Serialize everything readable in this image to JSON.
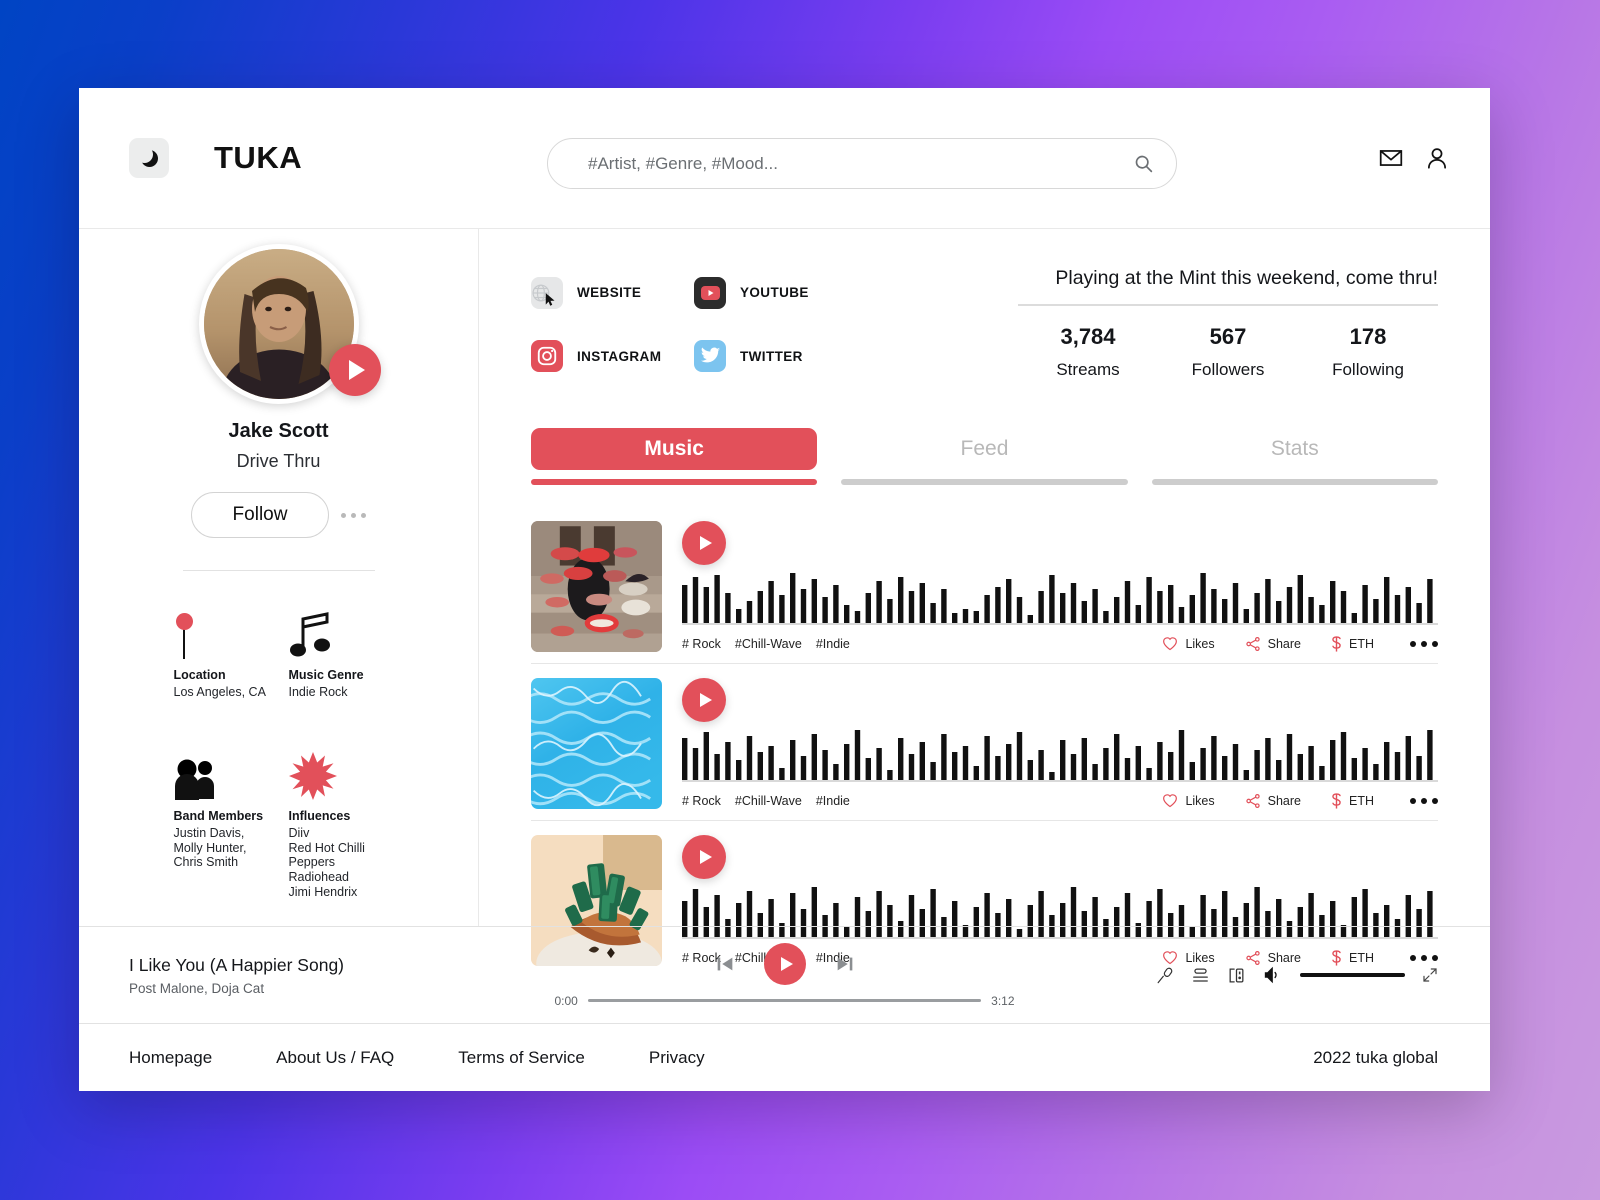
{
  "header": {
    "brand": "TUKA",
    "theme_toggle_icon": "moon-icon",
    "search_placeholder": "#Artist, #Genre, #Mood...",
    "search_value": "",
    "search_icon": "search-icon",
    "mail_icon": "mail-icon",
    "account_icon": "user-icon"
  },
  "sidebar": {
    "name": "Jake Scott",
    "subtitle": "Drive Thru",
    "follow_label": "Follow",
    "more_icon": "more-dots-icon",
    "play_icon": "play-icon",
    "info": [
      {
        "icon": "location-pin-icon",
        "title": "Location",
        "value": "Los Angeles, CA"
      },
      {
        "icon": "music-note-icon",
        "title": "Music Genre",
        "value": "Indie Rock"
      },
      {
        "icon": "band-members-icon",
        "title": "Band Members",
        "value": "Justin Davis,\nMolly Hunter,\nChris Smith"
      },
      {
        "icon": "starburst-icon",
        "title": "Influences",
        "value": "Diiv\nRed Hot Chilli\nPeppers\nRadiohead\nJimi Hendrix"
      }
    ]
  },
  "socials": [
    {
      "icon": "globe-icon",
      "label": "WEBSITE",
      "color": "#e6e7e8"
    },
    {
      "icon": "youtube-icon",
      "label": "YOUTUBE",
      "color": "#2c2c2c"
    },
    {
      "icon": "instagram-icon",
      "label": "INSTAGRAM",
      "color": "#e2505a"
    },
    {
      "icon": "twitter-icon",
      "label": "TWITTER",
      "color": "#7cc4ef"
    }
  ],
  "announcement": "Playing at the Mint this weekend, come thru!",
  "stats": [
    {
      "number": "3,784",
      "label": "Streams"
    },
    {
      "number": "567",
      "label": "Followers"
    },
    {
      "number": "178",
      "label": "Following"
    }
  ],
  "tabs": [
    {
      "label": "Music",
      "active": true
    },
    {
      "label": "Feed",
      "active": false
    },
    {
      "label": "Stats",
      "active": false
    }
  ],
  "tracks": [
    {
      "artwork": "lips-collage-artwork",
      "tags": [
        "# Rock",
        "#Chill-Wave",
        "#Indie"
      ],
      "likes_label": "Likes",
      "share_label": "Share",
      "eth_label": "ETH"
    },
    {
      "artwork": "pool-water-artwork",
      "tags": [
        "# Rock",
        "#Chill-Wave",
        "#Indie"
      ],
      "likes_label": "Likes",
      "share_label": "Share",
      "eth_label": "ETH"
    },
    {
      "artwork": "green-crystal-artwork",
      "tags": [
        "# Rock",
        "#Chill-Wave",
        "#Indie"
      ],
      "likes_label": "Likes",
      "share_label": "Share",
      "eth_label": "ETH"
    }
  ],
  "player": {
    "title": "I Like You (A Happier Song)",
    "artist": "Post Malone, Doja Cat",
    "current_time": "0:00",
    "total_time": "3:12",
    "progress_percent": 0,
    "volume_percent": 100,
    "prev_icon": "skip-previous-icon",
    "play_icon": "play-icon",
    "next_icon": "skip-next-icon",
    "mic_icon": "microphone-icon",
    "queue_icon": "queue-icon",
    "devices_icon": "devices-icon",
    "volume_icon": "volume-icon",
    "expand_icon": "expand-icon"
  },
  "footer": {
    "links": [
      "Homepage",
      "About Us / FAQ",
      "Terms of Service",
      "Privacy"
    ],
    "copyright": "2022  tuka global"
  },
  "theme": {
    "accent": "#e2505a",
    "text": "#14161a",
    "muted": "#b8b8b8"
  }
}
